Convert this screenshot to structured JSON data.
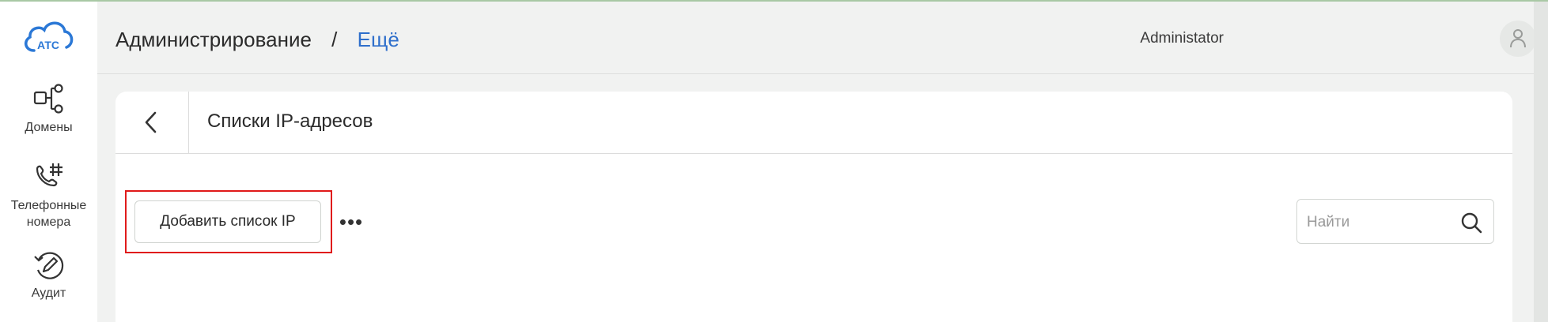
{
  "app": {
    "logo_text": "АТС"
  },
  "sidebar": {
    "items": [
      {
        "label": "Домены",
        "icon": "domains-icon"
      },
      {
        "label": "Телефонные номера",
        "icon": "phone-numbers-icon"
      },
      {
        "label": "Аудит",
        "icon": "audit-icon"
      }
    ]
  },
  "header": {
    "breadcrumb_root": "Администрирование",
    "breadcrumb_separator": "/",
    "breadcrumb_current": "Ещё",
    "user_name": "Administator"
  },
  "card": {
    "title": "Списки IP-адресов"
  },
  "toolbar": {
    "add_label": "Добавить список IP",
    "more_label": "•••"
  },
  "search": {
    "placeholder": "Найти",
    "value": ""
  },
  "colors": {
    "accent": "#2f6fcb",
    "highlight": "#e01a1a",
    "logo": "#2b78d6"
  }
}
